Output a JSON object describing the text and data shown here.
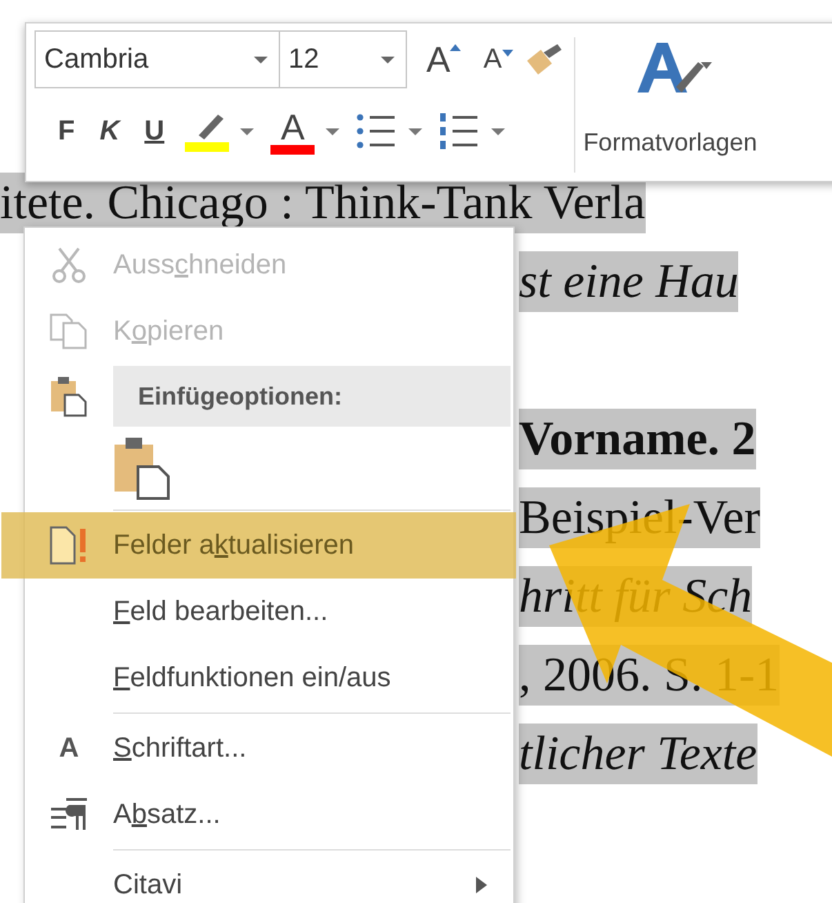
{
  "document": {
    "lines": [
      {
        "kind": "normal",
        "text": "itete. Chicago : Think-Tank Verla",
        "highlighted": true
      },
      {
        "kind": "italic",
        "text": "st eine Hau",
        "highlighted": true
      },
      {
        "kind": "normal"
      },
      {
        "kind": "bold",
        "text": "Vorname. 2",
        "highlighted": true
      },
      {
        "kind": "normal",
        "text": "Beispiel-Ver",
        "highlighted": true
      },
      {
        "kind": "italic",
        "text": "hritt für Sch",
        "highlighted": true
      },
      {
        "kind": "normal",
        "text": ", 2006. S. 1-1",
        "highlighted": true
      },
      {
        "kind": "italic",
        "text": "tlicher Texte",
        "highlighted": true
      }
    ]
  },
  "toolbar": {
    "font": "Cambria",
    "size": "12",
    "grow": "A",
    "shrink": "A",
    "format_buttons": [
      "F",
      "K",
      "U"
    ],
    "font_color_letter": "A",
    "styles_label": "Formatvorlagen"
  },
  "menu": {
    "items": [
      {
        "kind": "item",
        "parts": [
          {
            "text": "Auss",
            "underlined": false
          },
          {
            "text": "c",
            "underlined": true
          },
          {
            "text": "hneiden",
            "underlined": false
          }
        ],
        "disabled": true,
        "selected": false,
        "separator_before": false,
        "submenu": false
      },
      {
        "kind": "item",
        "parts": [
          {
            "text": "K",
            "underlined": false
          },
          {
            "text": "o",
            "underlined": true
          },
          {
            "text": "pieren",
            "underlined": false
          }
        ],
        "disabled": true,
        "selected": false,
        "separator_before": false,
        "submenu": false
      },
      {
        "kind": "header",
        "parts": [
          {
            "text": "Einfügeoptionen:",
            "underlined": false
          }
        ]
      },
      {
        "kind": "paste-options"
      },
      {
        "kind": "item",
        "parts": [
          {
            "text": "Felder a",
            "underlined": false
          },
          {
            "text": "k",
            "underlined": true
          },
          {
            "text": "tualisieren",
            "underlined": false
          }
        ],
        "disabled": false,
        "selected": true,
        "separator_before": true,
        "submenu": false
      },
      {
        "kind": "item",
        "parts": [
          {
            "text": "F",
            "underlined": true
          },
          {
            "text": "eld bearbeiten...",
            "underlined": false
          }
        ],
        "disabled": false,
        "selected": false,
        "separator_before": false,
        "submenu": false
      },
      {
        "kind": "item",
        "parts": [
          {
            "text": "F",
            "underlined": true
          },
          {
            "text": "eldfunktionen ein/aus",
            "underlined": false
          }
        ],
        "disabled": false,
        "selected": false,
        "separator_before": false,
        "submenu": false
      },
      {
        "kind": "item",
        "icon_text": "A",
        "parts": [
          {
            "text": "S",
            "underlined": true
          },
          {
            "text": "chriftart...",
            "underlined": false
          }
        ],
        "disabled": false,
        "selected": false,
        "separator_before": true,
        "submenu": false
      },
      {
        "kind": "item",
        "parts": [
          {
            "text": "A",
            "underlined": false
          },
          {
            "text": "b",
            "underlined": true
          },
          {
            "text": "satz...",
            "underlined": false
          }
        ],
        "disabled": false,
        "selected": false,
        "separator_before": false,
        "submenu": false
      },
      {
        "kind": "item",
        "parts": [
          {
            "text": "Citavi",
            "underlined": false
          }
        ],
        "disabled": false,
        "selected": false,
        "separator_before": true,
        "submenu": true
      }
    ]
  }
}
